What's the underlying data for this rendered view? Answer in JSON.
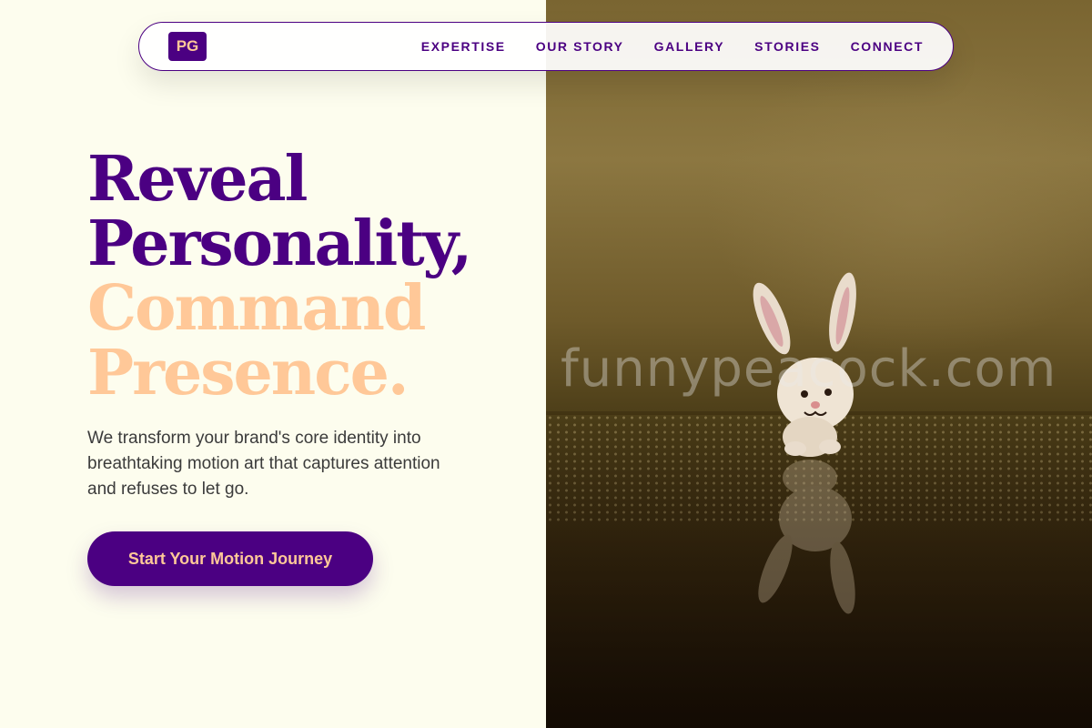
{
  "nav": {
    "logo": "PG",
    "links": [
      "EXPERTISE",
      "OUR STORY",
      "GALLERY",
      "STORIES",
      "CONNECT"
    ]
  },
  "hero": {
    "title_lines": [
      "Reveal",
      "Personality,",
      "Command",
      "Presence."
    ],
    "description": "We transform your brand's core identity into breathtaking motion art that captures attention and refuses to let go.",
    "cta_label": "Start Your Motion Journey"
  },
  "image": {
    "watermark": "funnypeacock.com"
  },
  "colors": {
    "primary": "#4b0082",
    "accent": "#ffc898",
    "background": "#fdfdee",
    "text": "#3b3b3b"
  }
}
